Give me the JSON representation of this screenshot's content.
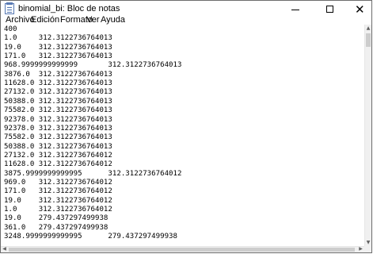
{
  "window": {
    "title": "binomial_bi: Bloc de notas",
    "controls": {
      "minimize": "minimize-icon",
      "maximize": "maximize-icon",
      "close": "close-icon"
    }
  },
  "menu": [
    "Archivo",
    "Edición",
    "Formato",
    "Ver",
    "Ayuda"
  ],
  "editor": {
    "lines": [
      "400",
      "1.0     312.3122736764013",
      "19.0    312.3122736764013",
      "171.0   312.3122736764013",
      "968.9999999999999       312.3122736764013",
      "3876.0  312.3122736764013",
      "11628.0 312.3122736764013",
      "27132.0 312.3122736764013",
      "50388.0 312.3122736764013",
      "75582.0 312.3122736764013",
      "92378.0 312.3122736764013",
      "92378.0 312.3122736764013",
      "75582.0 312.3122736764013",
      "50388.0 312.3122736764013",
      "27132.0 312.3122736764012",
      "11628.0 312.3122736764012",
      "3875.9999999999995      312.3122736764012",
      "969.0   312.3122736764012",
      "171.0   312.3122736764012",
      "19.0    312.3122736764012",
      "1.0     312.3122736764012",
      "19.0    279.437297499938",
      "361.0   279.437297499938",
      "3248.9999999999995      279.437297499938"
    ]
  }
}
